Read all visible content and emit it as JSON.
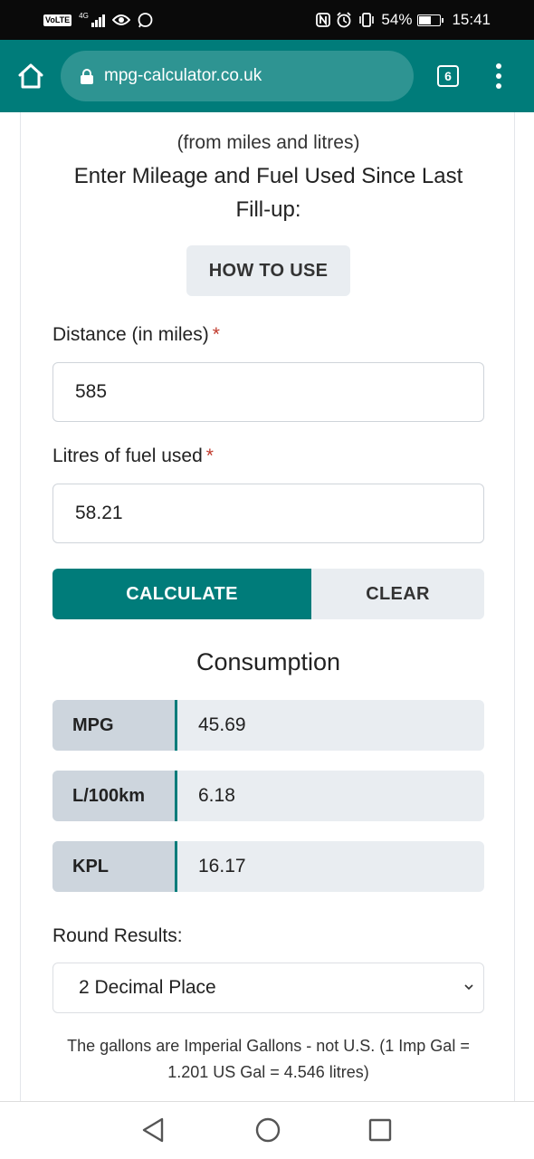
{
  "status_bar": {
    "volte": "VoLTE",
    "network": "4G",
    "battery": "54%",
    "battery_level": 0.54,
    "time": "15:41",
    "icons": [
      "signal-icon",
      "eye-icon",
      "whatsapp-icon",
      "nfc-icon",
      "alarm-icon",
      "vibrate-icon",
      "battery-icon"
    ]
  },
  "browser": {
    "url": "mpg-calculator.co.uk",
    "tab_count": "6",
    "icons": [
      "home-icon",
      "lock-icon",
      "tabs-icon",
      "menu-icon"
    ]
  },
  "page": {
    "subtitle": "(from miles and litres)",
    "heading": "Enter Mileage and Fuel Used Since Last Fill-up:",
    "how_to_use": "HOW TO USE",
    "distance_label": "Distance (in miles)",
    "distance_value": "585",
    "fuel_label": "Litres of fuel used",
    "fuel_value": "58.21",
    "required_mark": "*",
    "calculate": "CALCULATE",
    "clear": "CLEAR",
    "consumption_title": "Consumption",
    "results": [
      {
        "key": "MPG",
        "value": "45.69"
      },
      {
        "key": "L/100km",
        "value": "6.18"
      },
      {
        "key": "KPL",
        "value": "16.17"
      }
    ],
    "round_label": "Round Results:",
    "round_value": "2 Decimal Place",
    "note": "The gallons are Imperial Gallons - not U.S. (1 Imp Gal = 1.201 US Gal = 4.546 litres)"
  },
  "colors": {
    "accent": "#007c7a",
    "required": "#c0392b",
    "button_light": "#e9edf1",
    "result_key_bg": "#cdd5dd"
  },
  "nav": {
    "icons": [
      "back-icon",
      "home-circle-icon",
      "recents-icon"
    ]
  }
}
